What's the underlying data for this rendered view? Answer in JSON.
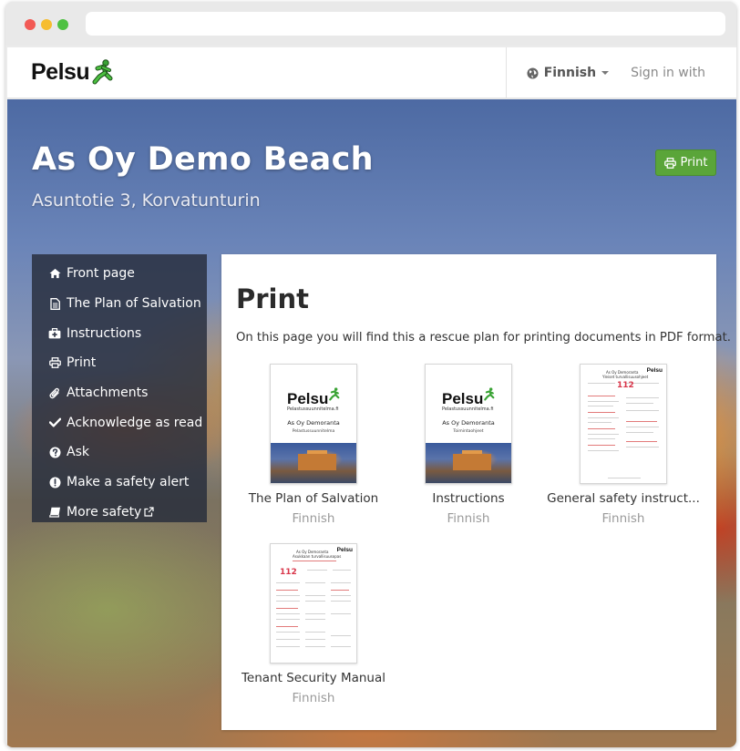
{
  "browser": {
    "url": ""
  },
  "navbar": {
    "logo_text": "Pelsu",
    "language_label": "Finnish",
    "signin_label": "Sign in with"
  },
  "hero": {
    "title": "As Oy Demo Beach",
    "subtitle": "Asuntotie 3, Korvatunturin",
    "print_label": "Print"
  },
  "sidebar": {
    "items": [
      {
        "label": "Front page",
        "icon": "home-icon"
      },
      {
        "label": "The Plan of Salvation",
        "icon": "document-icon"
      },
      {
        "label": "Instructions",
        "icon": "medkit-icon"
      },
      {
        "label": "Print",
        "icon": "printer-icon"
      },
      {
        "label": "Attachments",
        "icon": "paperclip-icon"
      },
      {
        "label": "Acknowledge as read",
        "icon": "check-icon"
      },
      {
        "label": "Ask",
        "icon": "question-icon"
      },
      {
        "label": "Make a safety alert",
        "icon": "exclamation-icon"
      },
      {
        "label": "More safety",
        "icon": "book-icon",
        "external_icon": "external-link-icon"
      }
    ]
  },
  "content": {
    "title": "Print",
    "intro": "On this page you will find this a rescue plan for printing documents in PDF format.",
    "documents": [
      {
        "name": "The Plan of Salvation",
        "language": "Finnish",
        "cover_logo": "Pelsu",
        "cover_tagline": "Pelastussuunnitelma.fi",
        "cover_title": "As Oy Demoranta",
        "cover_subtitle": "Pelastussuunnitelma"
      },
      {
        "name": "Instructions",
        "language": "Finnish",
        "cover_logo": "Pelsu",
        "cover_tagline": "Pelastussuunnitelma.fi",
        "cover_title": "As Oy Demoranta",
        "cover_subtitle": "Toimintaohjeet"
      },
      {
        "name": "General safety instruct...",
        "language": "Finnish",
        "sheet_logo": "Pelsu",
        "sheet_title": "As Oy Demoranta",
        "sheet_subtitle": "Yleiset turvallisuusohjeet",
        "sheet_number": "112"
      },
      {
        "name": "Tenant Security Manual",
        "language": "Finnish",
        "sheet_logo": "Pelsu",
        "sheet_title": "As Oy Demoranta",
        "sheet_subtitle": "Asukkaan turvallisuusopas",
        "sheet_number": "112"
      }
    ]
  },
  "colors": {
    "accent_green": "#5aa539",
    "sidebar_bg": "#262c3a",
    "emergency_red": "#d8364a"
  }
}
